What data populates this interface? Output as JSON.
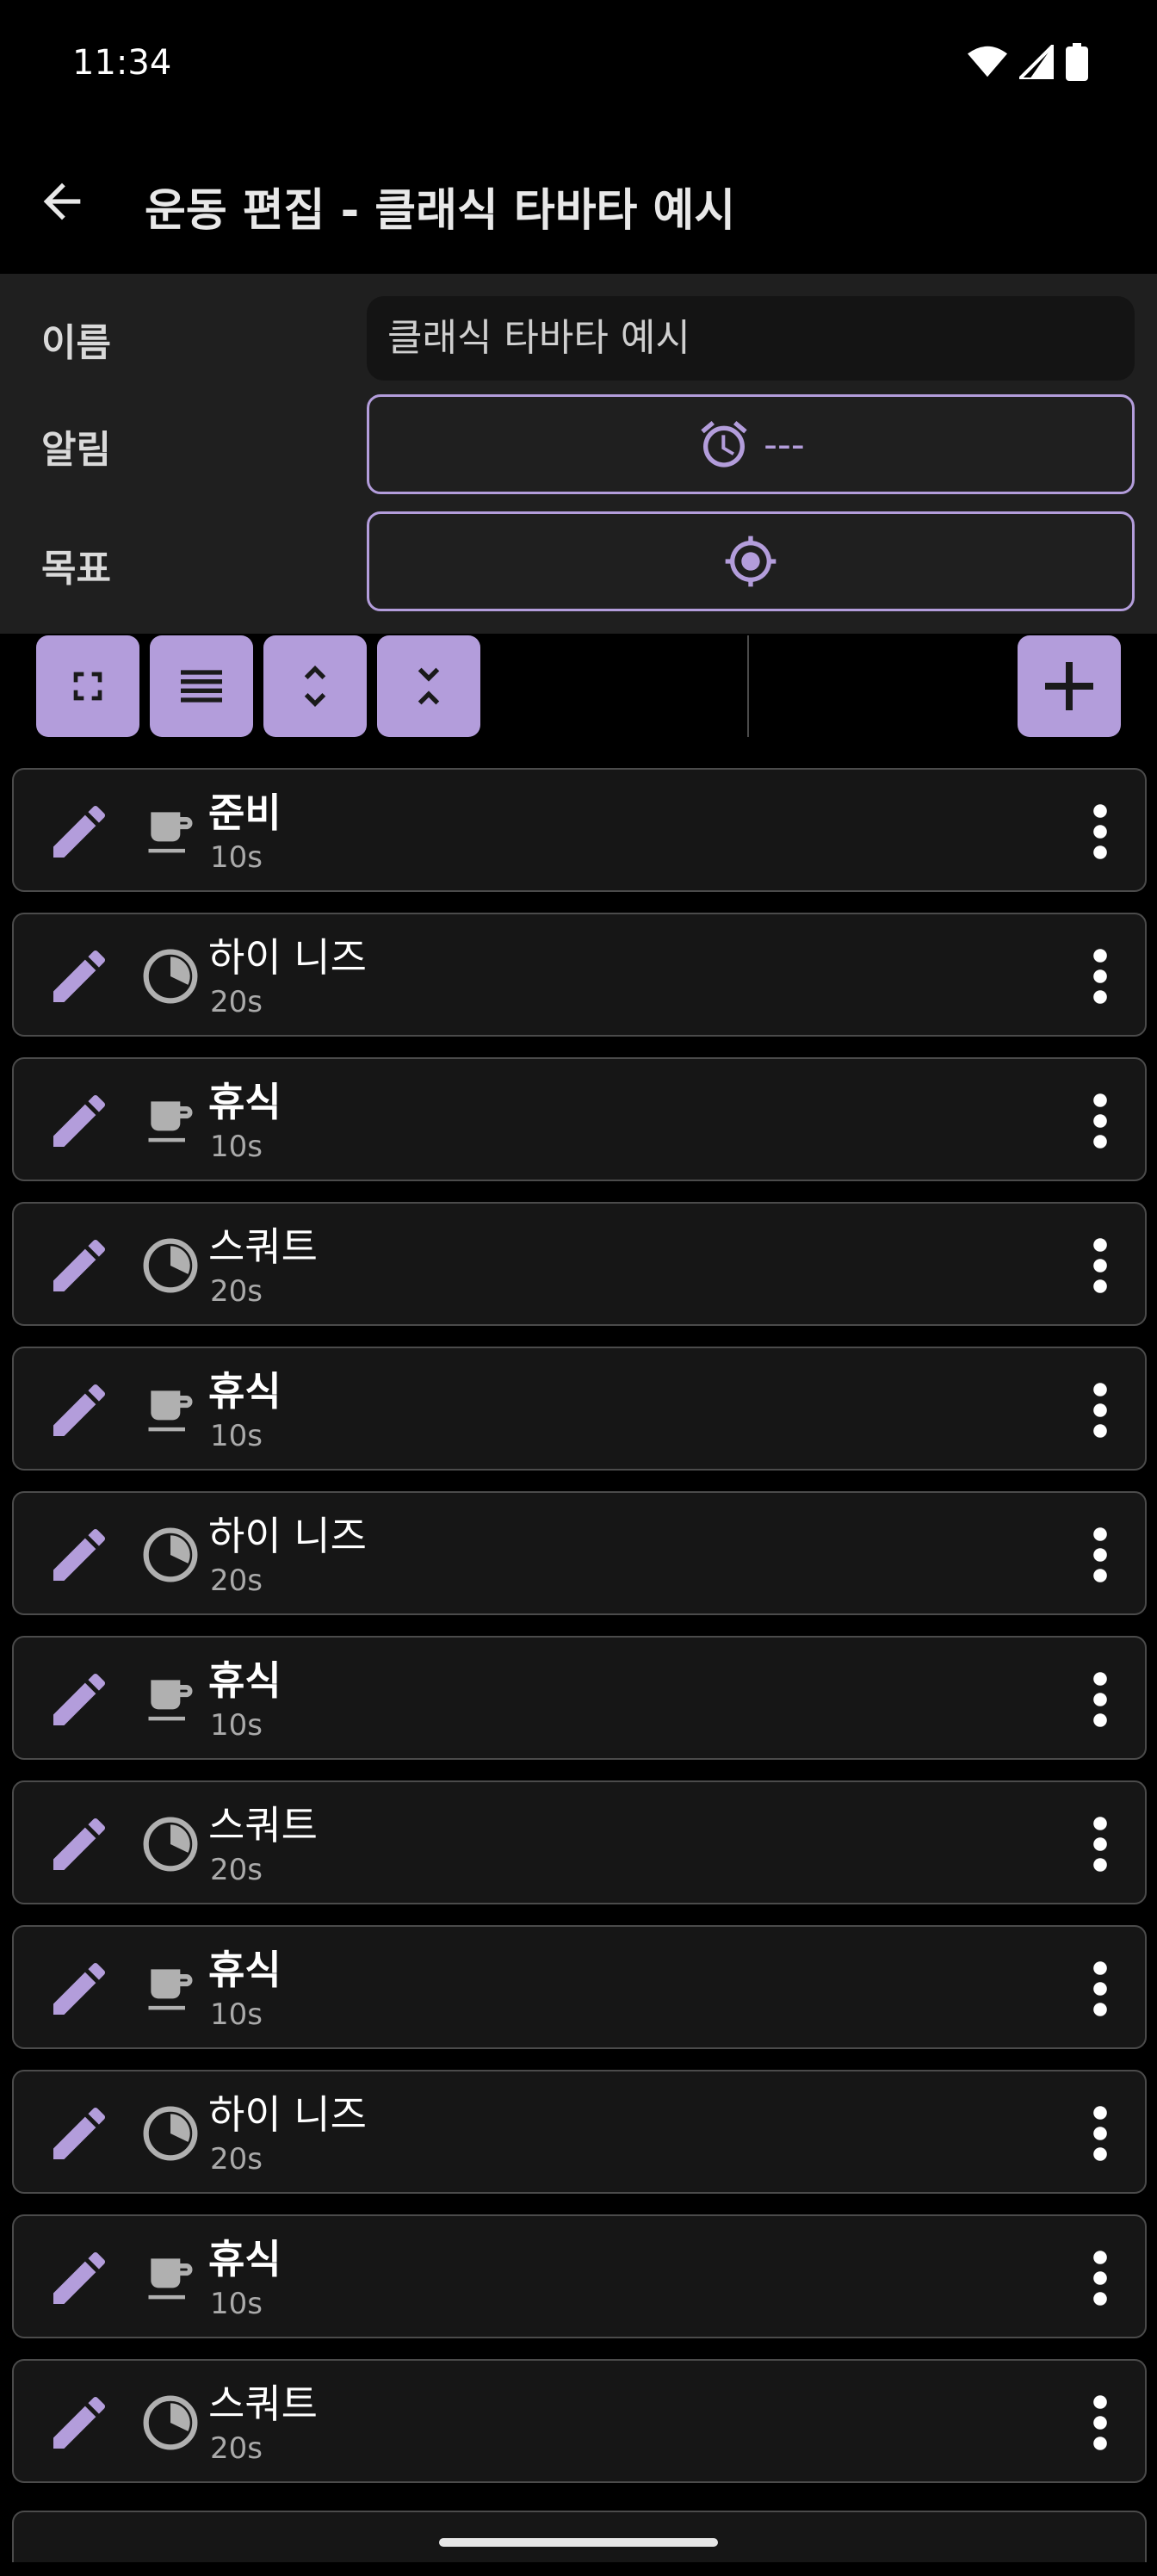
{
  "status": {
    "time": "11:34"
  },
  "app_bar": {
    "title": "운동 편집 - 클래식 타바타 예시"
  },
  "form": {
    "name_label": "이름",
    "name_value": "클래식 타바타 예시",
    "alarm_label": "알림",
    "alarm_value": "---",
    "goal_label": "목표"
  },
  "toolbar": {
    "buttons": [
      "expand-icon",
      "menu-lines-icon",
      "unfold-more-icon",
      "unfold-less-icon"
    ],
    "add": "plus-icon"
  },
  "colors": {
    "accent": "#b39ddb",
    "panel": "#1f1f1f",
    "row": "#161616"
  },
  "exercises": [
    {
      "name": "준비",
      "duration": "10s",
      "type": "rest",
      "bold": true
    },
    {
      "name": "하이 니즈",
      "duration": "20s",
      "type": "work",
      "bold": false
    },
    {
      "name": "휴식",
      "duration": "10s",
      "type": "rest",
      "bold": true
    },
    {
      "name": "스쿼트",
      "duration": "20s",
      "type": "work",
      "bold": false
    },
    {
      "name": "휴식",
      "duration": "10s",
      "type": "rest",
      "bold": true
    },
    {
      "name": "하이 니즈",
      "duration": "20s",
      "type": "work",
      "bold": false
    },
    {
      "name": "휴식",
      "duration": "10s",
      "type": "rest",
      "bold": true
    },
    {
      "name": "스쿼트",
      "duration": "20s",
      "type": "work",
      "bold": false
    },
    {
      "name": "휴식",
      "duration": "10s",
      "type": "rest",
      "bold": true
    },
    {
      "name": "하이 니즈",
      "duration": "20s",
      "type": "work",
      "bold": false
    },
    {
      "name": "휴식",
      "duration": "10s",
      "type": "rest",
      "bold": true
    },
    {
      "name": "스쿼트",
      "duration": "20s",
      "type": "work",
      "bold": false
    }
  ]
}
